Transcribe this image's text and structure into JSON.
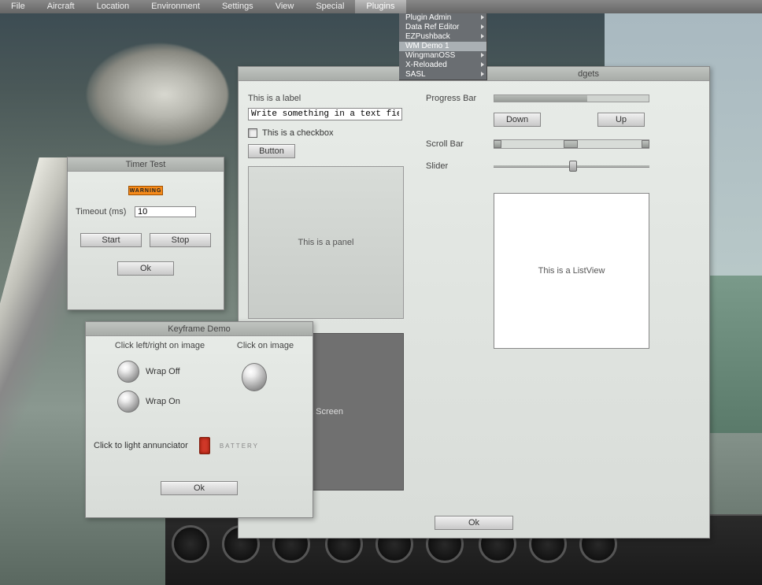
{
  "menu": {
    "items": [
      "File",
      "Aircraft",
      "Location",
      "Environment",
      "Settings",
      "View",
      "Special",
      "Plugins"
    ],
    "active_index": 7,
    "dropdown": [
      {
        "label": "Plugin Admin",
        "arrow": true
      },
      {
        "label": "Data Ref Editor",
        "arrow": true
      },
      {
        "label": "EZPushback",
        "arrow": true
      },
      {
        "label": "WM Demo 1",
        "arrow": false,
        "highlight": true
      },
      {
        "label": "WingmanOSS",
        "arrow": true
      },
      {
        "label": "X-Reloaded",
        "arrow": true
      },
      {
        "label": "SASL",
        "arrow": true
      }
    ]
  },
  "timer": {
    "title": "Timer Test",
    "warning": "WARNING",
    "timeout_label": "Timeout (ms)",
    "timeout_value": "10",
    "start": "Start",
    "stop": "Stop",
    "ok": "Ok"
  },
  "keyframe": {
    "title": "Keyframe Demo",
    "header_left": "Click left/right on image",
    "header_right": "Click on image",
    "wrap_off": "Wrap Off",
    "wrap_on": "Wrap On",
    "ann_label": "Click to light annunciator",
    "ann_text": "BATTERY",
    "ok": "Ok"
  },
  "main": {
    "title_partial": "dgets",
    "label": "This is a label",
    "text_value": "Write something in a text field",
    "checkbox_label": "This is a checkbox",
    "button": "Button",
    "panel_text": "This is a panel",
    "screen_text": "a Screen",
    "progress_label": "Progress Bar",
    "progress_pct": 60,
    "down": "Down",
    "up": "Up",
    "scroll_label": "Scroll Bar",
    "slider_label": "Slider",
    "listview_text": "This is a ListView",
    "ok": "Ok"
  }
}
